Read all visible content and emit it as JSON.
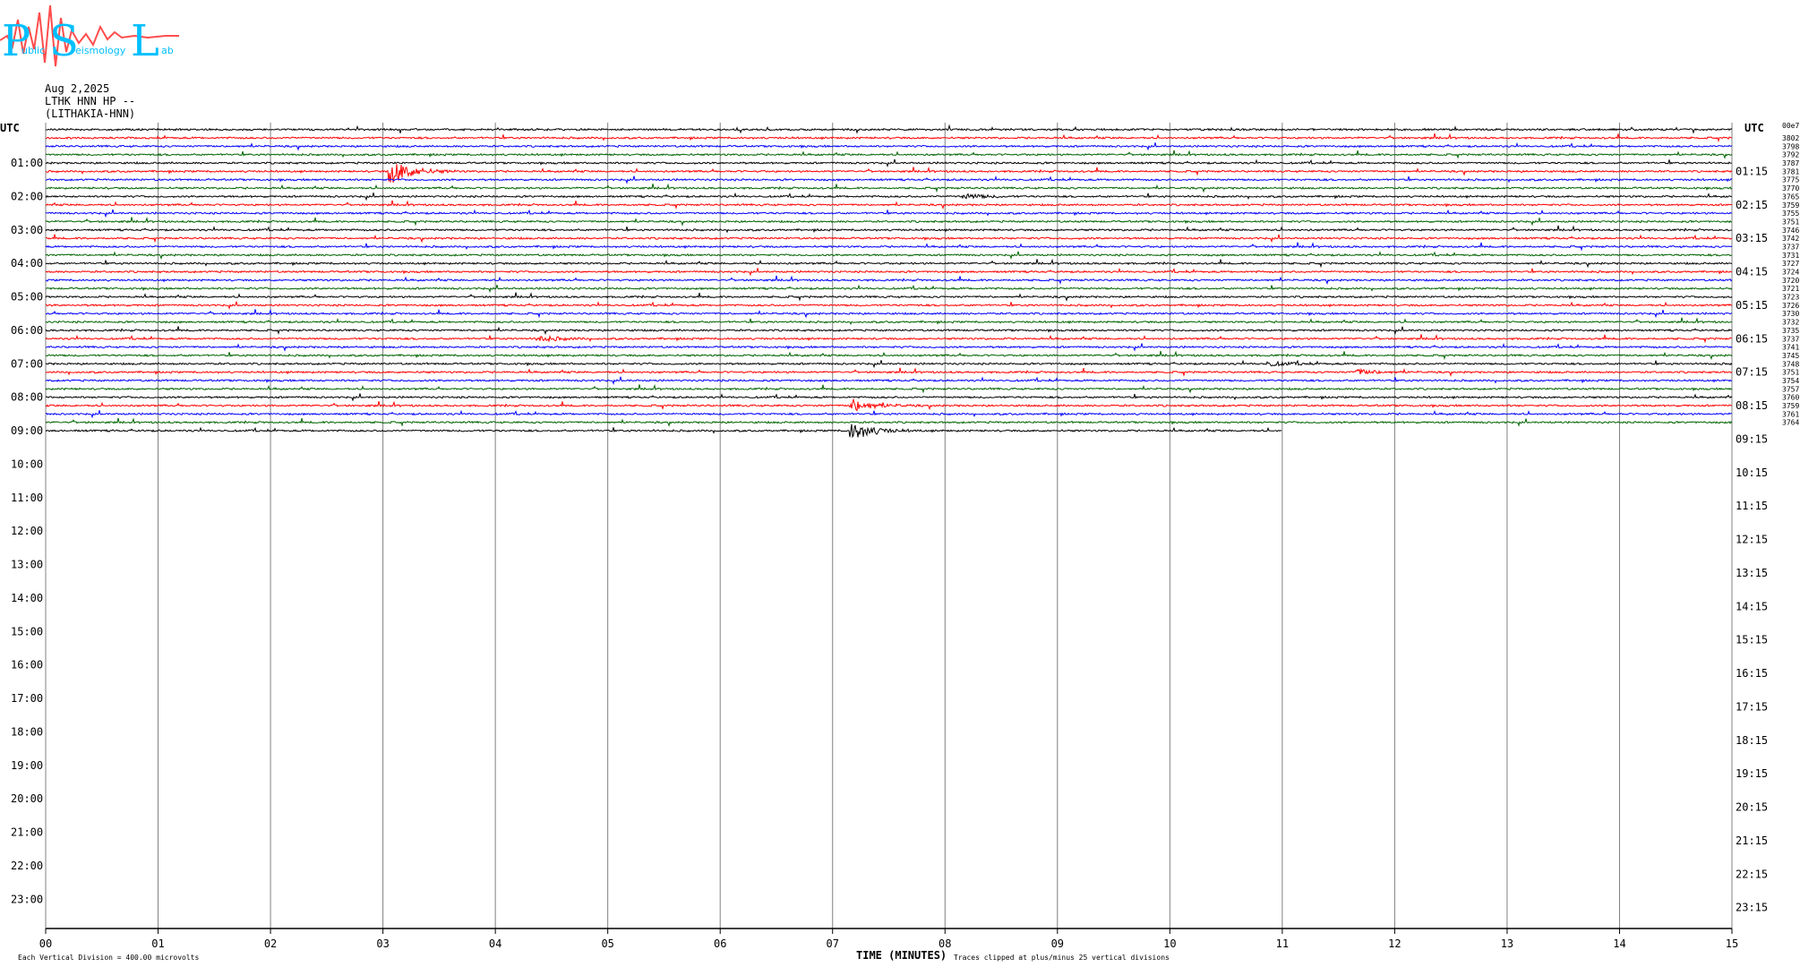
{
  "logo": {
    "letters": [
      "P",
      "S",
      "L"
    ],
    "words": [
      "ublic",
      "eismology",
      "ab"
    ]
  },
  "header": {
    "date": "Aug 2,2025",
    "station": "LTHK HNN HP --",
    "location": "(LITHAKIA-HNN)"
  },
  "footer": {
    "vertical_division": "Each Vertical Division =  400.00 microvolts",
    "clip_note": "Traces clipped at plus/minus 25 vertical divisions"
  },
  "colors": {
    "trace": [
      "#000000",
      "#ff0000",
      "#0000ff",
      "#006400"
    ],
    "grid": "#808080",
    "logo_letters": "#00bfff",
    "logo_wave": "#ff4d4d"
  },
  "chart_data": {
    "type": "line",
    "title": "",
    "xlabel": "TIME (MINUTES)",
    "ylabel": "UTC",
    "right_ylabel": "UTC",
    "xlim": [
      0,
      15
    ],
    "x_ticks": [
      "00",
      "01",
      "02",
      "03",
      "04",
      "05",
      "06",
      "07",
      "08",
      "09",
      "10",
      "11",
      "12",
      "13",
      "14",
      "15"
    ],
    "left_hours": [
      "01:00",
      "02:00",
      "03:00",
      "04:00",
      "05:00",
      "06:00",
      "07:00",
      "08:00",
      "09:00",
      "10:00",
      "11:00",
      "12:00",
      "13:00",
      "14:00",
      "15:00",
      "16:00",
      "17:00",
      "18:00",
      "19:00",
      "20:00",
      "21:00",
      "22:00",
      "23:00"
    ],
    "right_hours": [
      "01:15",
      "02:15",
      "03:15",
      "04:15",
      "05:15",
      "06:15",
      "07:15",
      "08:15",
      "09:15",
      "10:15",
      "11:15",
      "12:15",
      "13:15",
      "14:15",
      "15:15",
      "16:15",
      "17:15",
      "18:15",
      "19:15",
      "20:15",
      "21:15",
      "22:15",
      "23:15"
    ],
    "total_rows": 96,
    "rows_recorded": 37,
    "last_row_end_minute": 11.0,
    "trace_colors_cycle": [
      "black",
      "red",
      "blue",
      "green"
    ],
    "offsets_label": "00e7",
    "right_offsets": [
      "3802",
      "3798",
      "3792",
      "3787",
      "3781",
      "3775",
      "3770",
      "3765",
      "3759",
      "3755",
      "3751",
      "3746",
      "3742",
      "3737",
      "3731",
      "3727",
      "3724",
      "3720",
      "3721",
      "3723",
      "3726",
      "3730",
      "3732",
      "3735",
      "3737",
      "3741",
      "3745",
      "3748",
      "3751",
      "3754",
      "3757",
      "3760",
      "3759",
      "3761",
      "3764"
    ],
    "events": [
      {
        "row": 5,
        "minute": 3.1,
        "amplitude": 12
      },
      {
        "row": 8,
        "minute": 8.2,
        "amplitude": 2.5
      },
      {
        "row": 25,
        "minute": 4.4,
        "amplitude": 3
      },
      {
        "row": 33,
        "minute": 7.2,
        "amplitude": 6
      },
      {
        "row": 36,
        "minute": 7.2,
        "amplitude": 9
      },
      {
        "row": 29,
        "minute": 11.7,
        "amplitude": 2.5
      },
      {
        "row": 28,
        "minute": 10.9,
        "amplitude": 2
      }
    ]
  }
}
